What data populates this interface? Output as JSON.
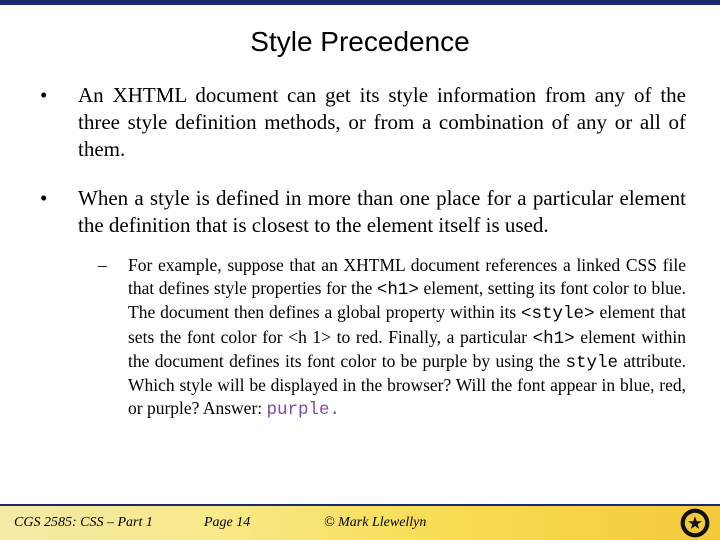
{
  "title": "Style Precedence",
  "bullets": {
    "b1": "An XHTML document can get its style information from any of the three style definition methods, or from a combination of any or all of them.",
    "b2": "When a style is defined in more than one place for a particular element the definition that is closest to the element itself is used.",
    "sub1_part1": "For example, suppose that an XHTML document references a linked CSS file that defines style properties for the ",
    "sub1_code1": "<h1>",
    "sub1_part2": " element, setting its font color to blue.  The document then defines a global property within its ",
    "sub1_code2": "<style>",
    "sub1_part3": " element that sets the font color for <h 1> to red.  Finally, a particular ",
    "sub1_code3": "<h1>",
    "sub1_part4": " element within the document defines its font color to be purple by using the ",
    "sub1_code4": "style",
    "sub1_part5": " attribute.  Which style will be displayed in the browser?  Will the font appear in blue, red, or purple?  Answer:   ",
    "sub1_answer": "purple."
  },
  "footer": {
    "course": "CGS 2585: CSS – Part 1",
    "page": "Page 14",
    "copy": "© Mark Llewellyn"
  }
}
